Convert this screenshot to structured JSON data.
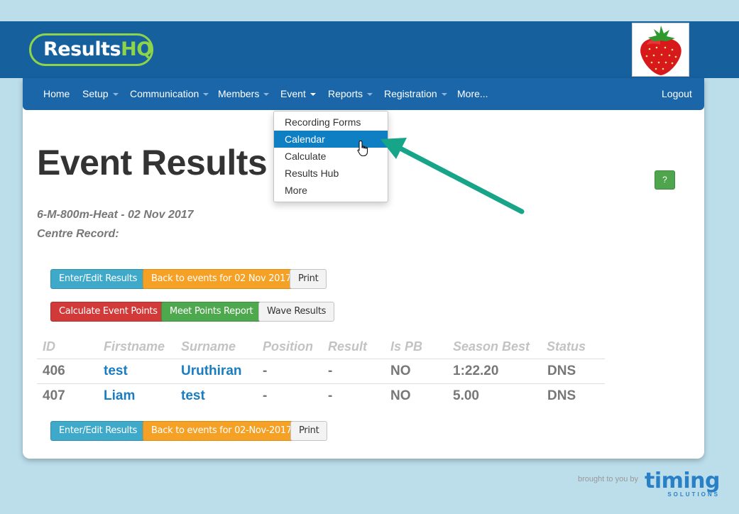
{
  "header": {
    "logo_main": "Results",
    "logo_accent": "HQ",
    "badge_icon": "strawberry-icon"
  },
  "nav": {
    "items": [
      {
        "label": "Home",
        "has_caret": false
      },
      {
        "label": "Setup",
        "has_caret": true
      },
      {
        "label": "Communication",
        "has_caret": true
      },
      {
        "label": "Members",
        "has_caret": true
      },
      {
        "label": "Event",
        "has_caret": true
      },
      {
        "label": "Reports",
        "has_caret": true
      },
      {
        "label": "Registration",
        "has_caret": true
      },
      {
        "label": "More...",
        "has_caret": false
      }
    ],
    "logout": "Logout"
  },
  "dropdown": {
    "items": [
      "Recording Forms",
      "Calendar",
      "Calculate",
      "Results Hub",
      "More"
    ],
    "active_index": 1
  },
  "page": {
    "title": "Event Results",
    "event_line": "6-M-800m-Heat - 02 Nov 2017",
    "record_line": "Centre Record:",
    "help_label": "?"
  },
  "buttons": {
    "enter_edit": "Enter/Edit Results",
    "back_top": "Back to events for 02 Nov 2017",
    "print": "Print",
    "calc_points": "Calculate Event Points",
    "meet_points": "Meet Points Report",
    "wave_results": "Wave Results",
    "back_bottom": "Back to events for 02-Nov-2017"
  },
  "table": {
    "headers": [
      "ID",
      "Firstname",
      "Surname",
      "Position",
      "Result",
      "Is PB",
      "Season Best",
      "Status"
    ],
    "rows": [
      [
        "406",
        "test",
        "Uruthiran",
        "-",
        "-",
        "NO",
        "1:22.20",
        "DNS"
      ],
      [
        "407",
        "Liam",
        "test",
        "-",
        "-",
        "NO",
        "5.00",
        "DNS"
      ]
    ]
  },
  "footer": {
    "brought_by": "brought to you by",
    "brand": "timing",
    "brand_sub": "SOLUTIONS"
  },
  "colors": {
    "header_bg": "#17609e",
    "nav_bg": "#1a66a8",
    "accent_green": "#8dd44a",
    "arrow": "#17a589",
    "link": "#1a7cc1"
  }
}
